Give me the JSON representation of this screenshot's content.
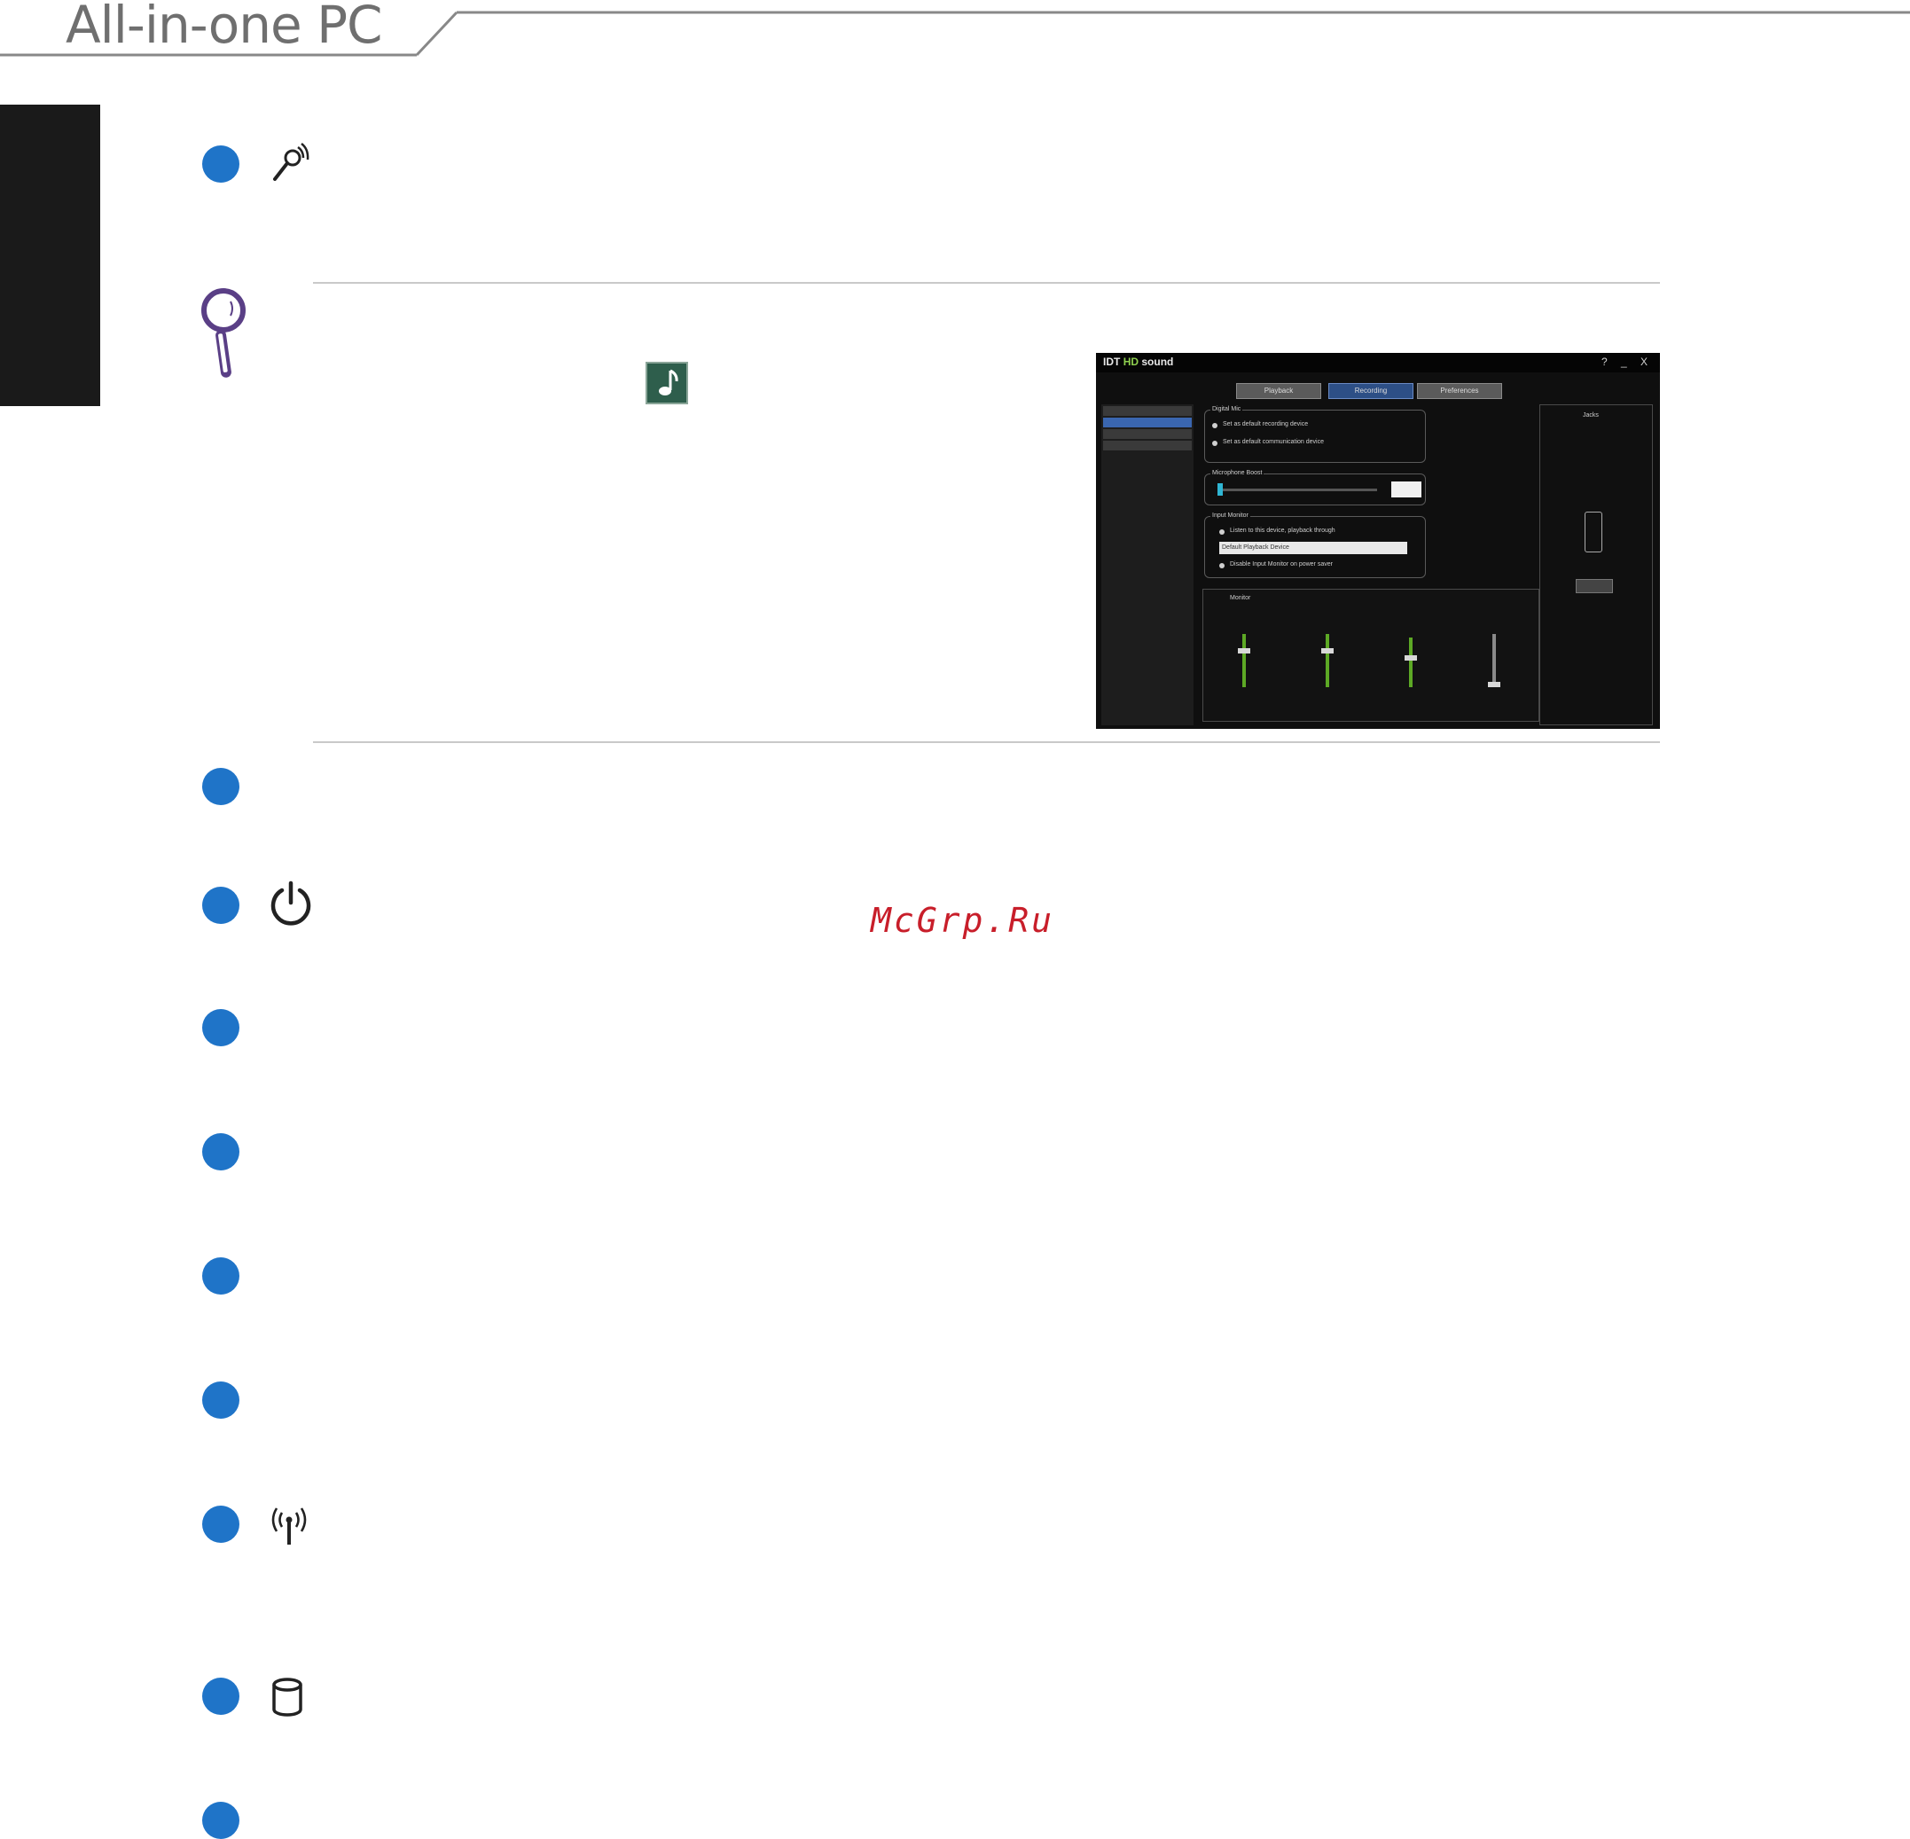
{
  "header": {
    "title": "All-in-one PC"
  },
  "watermark": "McGrp.Ru",
  "screenshot": {
    "brand_prefix": "IDT",
    "brand_hd": "HD",
    "brand_word": "sound",
    "window_buttons": "? _ X",
    "tabs": [
      "Playback",
      "Recording",
      "Preferences"
    ],
    "group1_title": "Digital Mic",
    "group1_option1": "Set as default recording device",
    "group1_option2": "Set as default communication device",
    "group2_title": "Microphone Boost",
    "group3_title": "Input Monitor",
    "group3_option1": "Listen to this device, playback through",
    "group3_select": "Default Playback Device",
    "group3_option2": "Disable Input Monitor on power saver",
    "mixer_label": "Monitor",
    "right_title": "Jacks"
  },
  "colors": {
    "bullet": "#1f74c8",
    "header_text": "#6f6f6f",
    "side_tab": "#1a1a1a",
    "watermark": "#c81e2a"
  },
  "icons": [
    "microphone-icon",
    "note-magnifier-icon",
    "sound-manager-icon",
    "power-icon",
    "wireless-icon",
    "hard-drive-icon"
  ]
}
